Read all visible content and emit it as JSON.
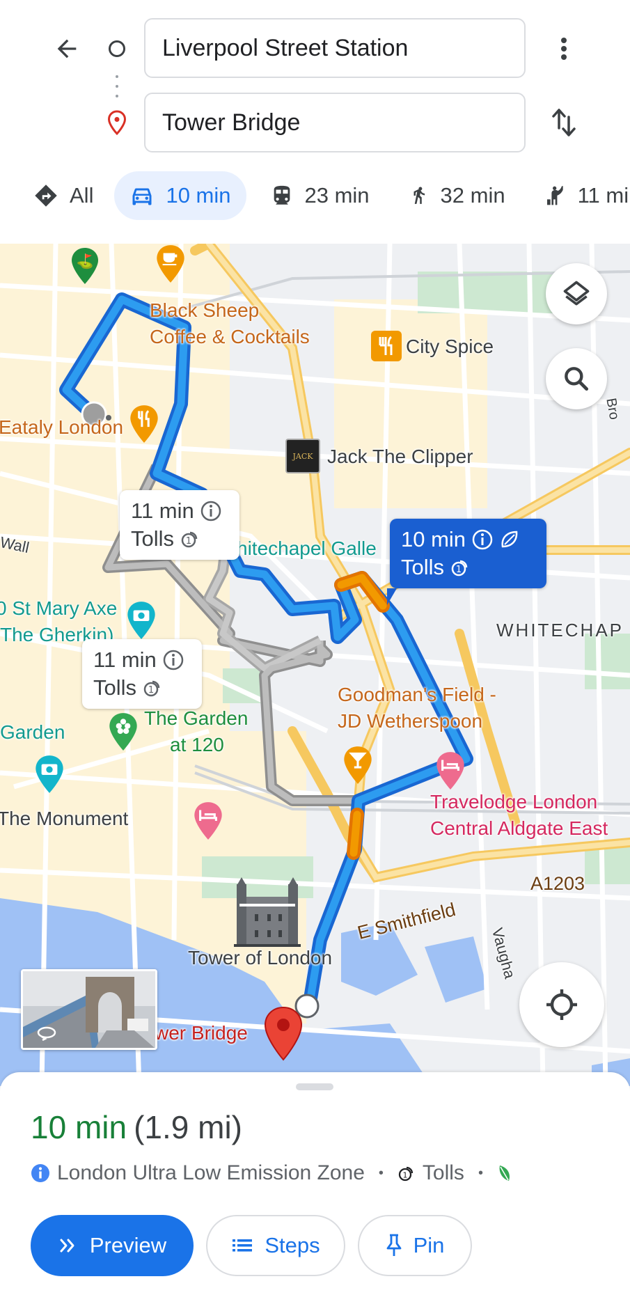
{
  "header": {
    "back_icon": "arrow-left-icon",
    "origin": {
      "value": "Liverpool Street Station",
      "icon": "origin-circle-icon"
    },
    "destination": {
      "value": "Tower Bridge",
      "icon": "destination-pin-icon"
    },
    "more_icon": "more-vert-icon",
    "swap_icon": "swap-vert-icon"
  },
  "modes": [
    {
      "id": "all",
      "label": "All",
      "icon": "directions-icon",
      "active": false
    },
    {
      "id": "drive",
      "label": "10 min",
      "icon": "car-icon",
      "active": true
    },
    {
      "id": "transit",
      "label": "23 min",
      "icon": "train-icon",
      "active": false
    },
    {
      "id": "walk",
      "label": "32 min",
      "icon": "walk-icon",
      "active": false
    },
    {
      "id": "ride",
      "label": "11 mi",
      "icon": "ride-hail-icon",
      "active": false
    }
  ],
  "map": {
    "labels": {
      "black_sheep_1": "Black Sheep",
      "black_sheep_2": "Coffee & Cocktails",
      "city_spice": "City Spice",
      "eataly": "Eataly London",
      "jack": "Jack The Clipper",
      "whitechapel_gallery": "hitechapel Galle",
      "whitechapel": "WHITECHAP",
      "st_mary_axe_1": "0 St Mary Axe",
      "st_mary_axe_2": "The Gherkin)",
      "wall": "Wall",
      "goodmans_1": "Goodman's Field -",
      "goodmans_2": "JD Wetherspoon",
      "garden_left": "Garden",
      "garden_120_1": "The Garden",
      "garden_120_2": "at 120",
      "monument": "The Monument",
      "travelodge_1": "Travelodge London",
      "travelodge_2": "Central Aldgate East",
      "a1203": "A1203",
      "smithfield": "E Smithfield",
      "vaughan": "Vaugha",
      "tower_of_london": "Tower of London",
      "tower_bridge": "wer Bridge",
      "bro": "Bro"
    },
    "callouts": {
      "primary": {
        "time": "10 min",
        "tolls": "Tolls"
      },
      "alt1": {
        "time": "11 min",
        "tolls": "Tolls"
      },
      "alt2": {
        "time": "11 min",
        "tolls": "Tolls"
      }
    },
    "controls": {
      "layers_icon": "layers-icon",
      "search_icon": "search-icon",
      "locate_icon": "my-location-icon"
    },
    "colors": {
      "route_primary": "#1a73e8",
      "route_primary_inner": "#2d9bf0",
      "route_alt": "#9e9e9e",
      "traffic_slow": "#f29900",
      "water": "#9fc1f5",
      "park": "#c8e6c9"
    }
  },
  "sheet": {
    "time": "10 min",
    "distance": "(1.9 mi)",
    "zone": "London Ultra Low Emission Zone",
    "tolls": "Tolls",
    "buttons": {
      "preview": "Preview",
      "steps": "Steps",
      "pin": "Pin"
    },
    "colors": {
      "time": "#188038",
      "accent": "#1a73e8"
    }
  }
}
